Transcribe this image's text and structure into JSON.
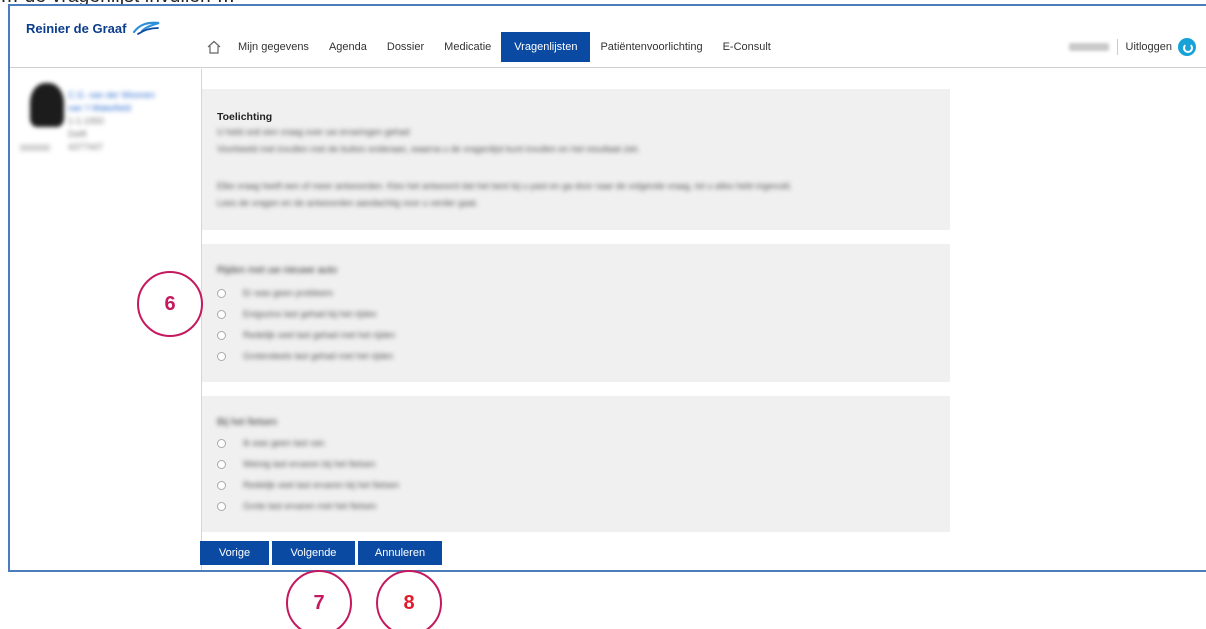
{
  "caption": "… de vragenlijst invullen …",
  "header": {
    "logo_text": "Reinier de Graaf",
    "nav": [
      {
        "label": "Mijn gegevens",
        "active": false
      },
      {
        "label": "Agenda",
        "active": false
      },
      {
        "label": "Dossier",
        "active": false
      },
      {
        "label": "Medicatie",
        "active": false
      },
      {
        "label": "Vragenlijsten",
        "active": true
      },
      {
        "label": "Patiëntenvoorlichting",
        "active": false
      },
      {
        "label": "E-Consult",
        "active": false
      }
    ],
    "user_name": "xxxxxxx",
    "logout_label": "Uitloggen"
  },
  "profile": {
    "name_line1": "C.G. van der Woonen",
    "name_line2": "van 't Wakefield",
    "dob": "1-1-1950",
    "city": "Delft",
    "phone": "4377447",
    "id": "000000"
  },
  "toelichting": {
    "title": "Toelichting",
    "line1": "U hebt ooit een vraag over uw ervaringen gehad",
    "line2": "Voorbeeld met invullen met de button onderaan, waarna u de vragenlijst kunt invullen en het resultaat ziet.",
    "line3": "Elke vraag heeft een of meer antwoorden. Kies het antwoord dat het best bij u past en ga door naar de volgende vraag, tot u alles hebt ingevuld.",
    "line4": "Lees de vragen en de antwoorden aandachtig voor u verder gaat."
  },
  "question1": {
    "title": "Rijden met uw nieuwe auto",
    "options": [
      "Er was geen probleem",
      "Enigszins last gehad bij het rijden",
      "Redelijk veel last gehad met het rijden",
      "Grotendeels last gehad met het rijden"
    ]
  },
  "question2": {
    "title": "Bij het fietsen",
    "options": [
      "Ik was geen last van",
      "Weinig last ervaren bij het fietsen",
      "Redelijk veel last ervaren bij het fietsen",
      "Grote last ervaren met het fietsen"
    ]
  },
  "buttons": {
    "prev": "Vorige",
    "next": "Volgende",
    "cancel": "Annuleren"
  },
  "annotations": {
    "six": "6",
    "seven": "7",
    "eight": "8"
  },
  "colors": {
    "brand": "#0b4aa3",
    "annotation": "#c5195f",
    "panel": "#f0f0f0"
  }
}
